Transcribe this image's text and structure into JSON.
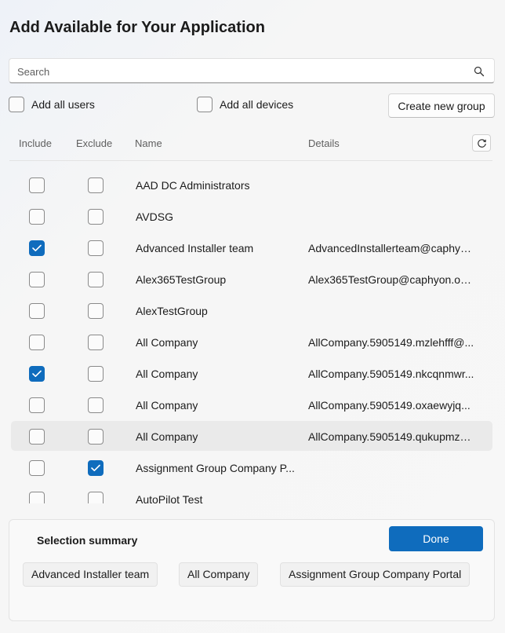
{
  "dialog": {
    "title": "Add Available for Your Application"
  },
  "search": {
    "placeholder": "Search"
  },
  "options": {
    "add_all_users": "Add all users",
    "add_all_devices": "Add all devices",
    "create_new_group": "Create new group"
  },
  "table": {
    "headers": {
      "include": "Include",
      "exclude": "Exclude",
      "name": "Name",
      "details": "Details"
    },
    "rows": [
      {
        "name": "AAD DC Administrators",
        "details": "",
        "include": false,
        "exclude": false
      },
      {
        "name": "AVDSG",
        "details": "",
        "include": false,
        "exclude": false
      },
      {
        "name": "Advanced Installer team",
        "details": "AdvancedInstallerteam@caphyo...",
        "include": true,
        "exclude": false
      },
      {
        "name": "Alex365TestGroup",
        "details": "Alex365TestGroup@caphyon.on...",
        "include": false,
        "exclude": false
      },
      {
        "name": "AlexTestGroup",
        "details": "",
        "include": false,
        "exclude": false
      },
      {
        "name": "All Company",
        "details": "AllCompany.5905149.mzlehfff@...",
        "include": false,
        "exclude": false
      },
      {
        "name": "All Company",
        "details": "AllCompany.5905149.nkcqnmwr...",
        "include": true,
        "exclude": false
      },
      {
        "name": "All Company",
        "details": "AllCompany.5905149.oxaewyjq...",
        "include": false,
        "exclude": false
      },
      {
        "name": "All Company",
        "details": "AllCompany.5905149.qukupmza...",
        "include": false,
        "exclude": false
      },
      {
        "name": "Assignment Group Company P...",
        "details": "",
        "include": false,
        "exclude": true
      },
      {
        "name": "AutoPilot Test",
        "details": "",
        "include": false,
        "exclude": false
      }
    ]
  },
  "summary": {
    "title": "Selection summary",
    "done_label": "Done",
    "chips": [
      "Advanced Installer team",
      "All Company",
      "Assignment Group Company Portal"
    ]
  },
  "colors": {
    "accent": "#0f6cbd"
  },
  "icons": {
    "search": "search-icon",
    "refresh": "refresh-icon",
    "check": "checkmark-icon"
  }
}
